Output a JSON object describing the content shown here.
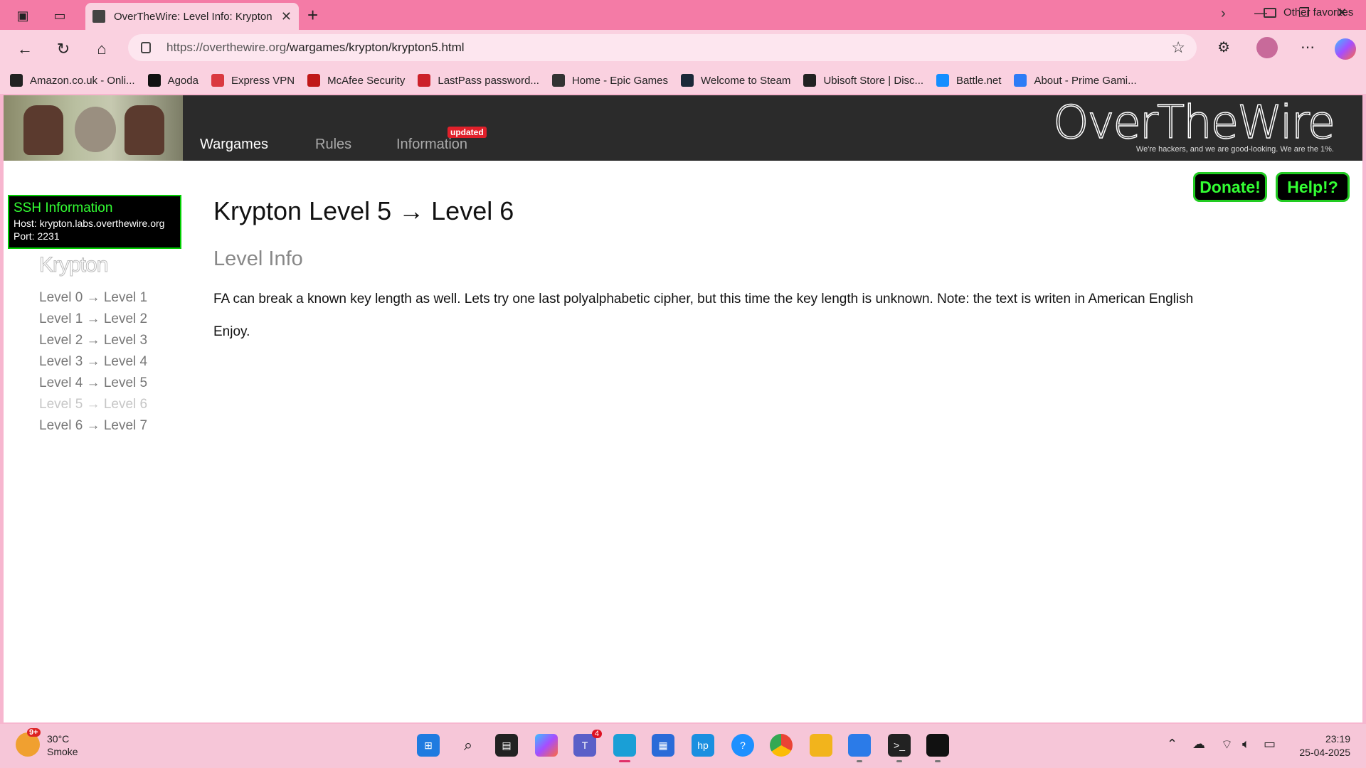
{
  "browser": {
    "tab_title": "OverTheWire: Level Info: Krypton",
    "url_host": "https://overthewire.org",
    "url_path": "/wargames/krypton/krypton5.html"
  },
  "bookmarks": [
    {
      "label": "Amazon.co.uk - Onli...",
      "icon": "amazon-icon",
      "color": "#222222"
    },
    {
      "label": "Agoda",
      "icon": "hp-icon",
      "color": "#111111"
    },
    {
      "label": "Express VPN",
      "icon": "expressvpn-icon",
      "color": "#da3940"
    },
    {
      "label": "McAfee Security",
      "icon": "mcafee-icon",
      "color": "#c01818"
    },
    {
      "label": "LastPass password...",
      "icon": "lastpass-icon",
      "color": "#cc2029"
    },
    {
      "label": "Home - Epic Games",
      "icon": "epic-icon",
      "color": "#333333"
    },
    {
      "label": "Welcome to Steam",
      "icon": "steam-icon",
      "color": "#1b2838"
    },
    {
      "label": "Ubisoft Store | Disc...",
      "icon": "ubisoft-icon",
      "color": "#222222"
    },
    {
      "label": "Battle.net",
      "icon": "battlenet-icon",
      "color": "#148eff"
    },
    {
      "label": "About - Prime Gami...",
      "icon": "prime-gaming-icon",
      "color": "#2d7cf6"
    }
  ],
  "bookmarks_other": "Other favorites",
  "site": {
    "nav": [
      "Wargames",
      "Rules",
      "Information"
    ],
    "nav_badge": "updated",
    "logo": "OverTheWire",
    "tagline": "We're hackers, and we are good-looking. We are the 1%."
  },
  "ssh": {
    "title": "SSH Information",
    "host": "Host: krypton.labs.overthewire.org",
    "port": "Port: 2231"
  },
  "sidebar": {
    "title": "Krypton",
    "levels": [
      "Level 0 → Level 1",
      "Level 1 → Level 2",
      "Level 2 → Level 3",
      "Level 3 → Level 4",
      "Level 4 → Level 5",
      "Level 5 → Level 6",
      "Level 6 → Level 7"
    ],
    "current_index": 5
  },
  "main": {
    "title": "Krypton Level 5 → Level 6",
    "subtitle": "Level Info",
    "paragraph": "FA can break a known key length as well. Lets try one last polyalphabetic cipher, but this time the key length is unknown. Note: the text is writen in American English",
    "enjoy": "Enjoy."
  },
  "buttons": {
    "donate": "Donate!",
    "help": "Help!?"
  },
  "taskbar": {
    "weather_temp": "30°C",
    "weather_desc": "Smoke",
    "weather_badge": "9+",
    "teams_badge": "4",
    "time": "23:19",
    "date": "25-04-2025"
  },
  "colors": {
    "accent_green": "#33ff33",
    "header_bg": "#2b2b2b",
    "chrome_pink": "#f47ba6"
  }
}
